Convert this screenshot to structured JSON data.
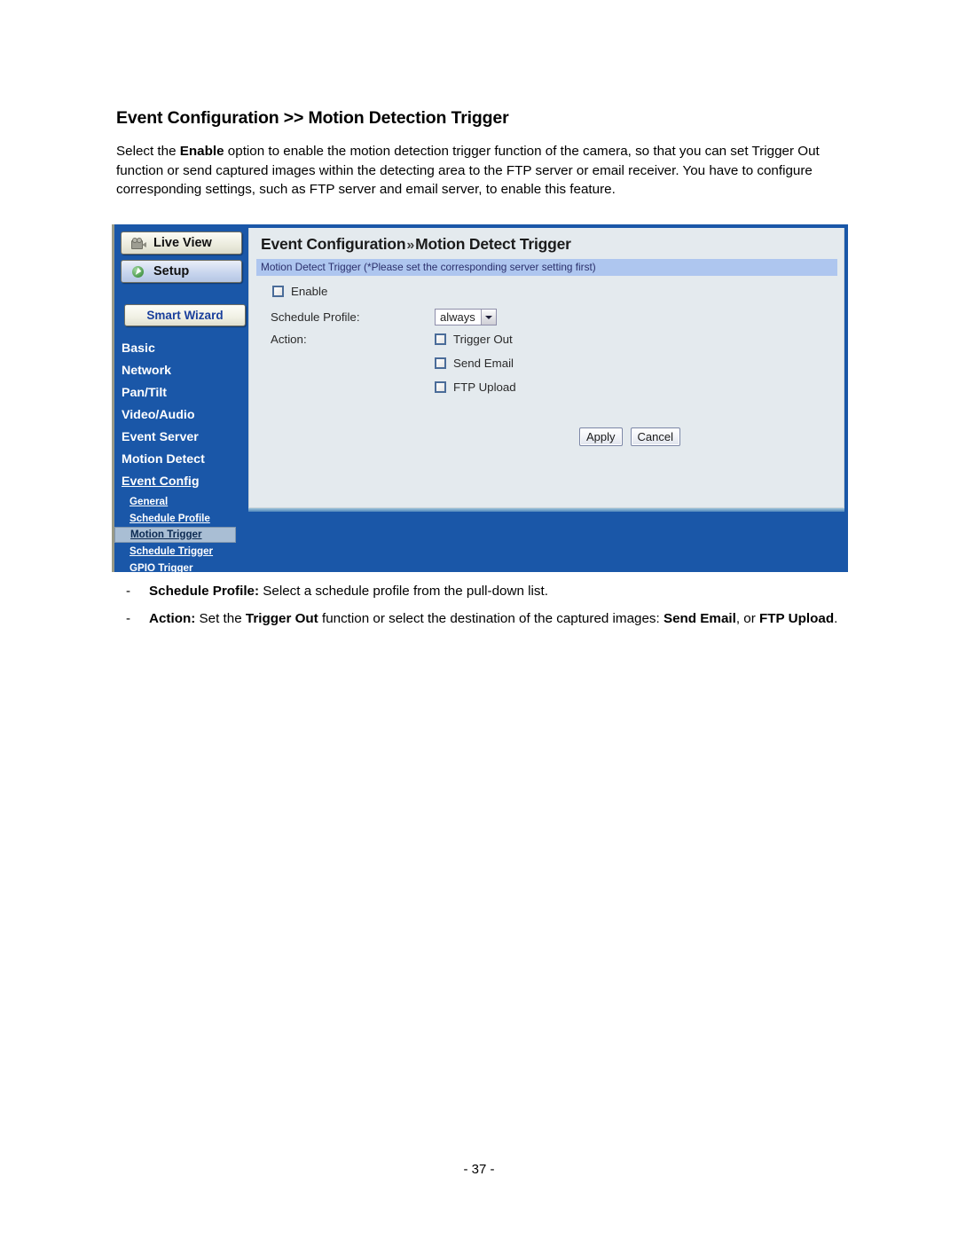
{
  "document": {
    "title": "Event Configuration >> Motion Detection Trigger",
    "intro_segments": [
      {
        "text": "Select the ",
        "bold": false
      },
      {
        "text": "Enable",
        "bold": true
      },
      {
        "text": " option to enable the motion detection trigger function of the camera, so that you can set Trigger Out function or send captured images within the detecting area to the FTP server or email receiver. You have to configure corresponding settings, such as FTP server and email server, to enable this feature.",
        "bold": false
      }
    ],
    "page_number": "- 37 -"
  },
  "notes": [
    {
      "dash": "-",
      "segments": [
        {
          "text": "Schedule Profile:",
          "bold": true
        },
        {
          "text": " Select a schedule profile from the pull-down list.",
          "bold": false
        }
      ]
    },
    {
      "dash": "-",
      "segments": [
        {
          "text": "Action:",
          "bold": true
        },
        {
          "text": " Set the ",
          "bold": false
        },
        {
          "text": "Trigger Out",
          "bold": true
        },
        {
          "text": " function or select the destination of the captured images: ",
          "bold": false
        },
        {
          "text": "Send Email",
          "bold": true
        },
        {
          "text": ", or ",
          "bold": false
        },
        {
          "text": "FTP Upload",
          "bold": true
        },
        {
          "text": ".",
          "bold": false
        }
      ]
    }
  ],
  "camera_ui": {
    "sidebar": {
      "live_view_label": "Live View",
      "setup_label": "Setup",
      "smart_wizard_label": "Smart Wizard",
      "main_items": [
        {
          "label": "Basic",
          "active": false
        },
        {
          "label": "Network",
          "active": false
        },
        {
          "label": "Pan/Tilt",
          "active": false
        },
        {
          "label": "Video/Audio",
          "active": false
        },
        {
          "label": "Event Server",
          "active": false
        },
        {
          "label": "Motion Detect",
          "active": false
        },
        {
          "label": "Event Config",
          "active": true
        }
      ],
      "sub_items": [
        {
          "label": "General",
          "selected": false
        },
        {
          "label": "Schedule Profile",
          "selected": false
        },
        {
          "label": "Motion Trigger",
          "selected": true
        },
        {
          "label": "Schedule Trigger",
          "selected": false
        },
        {
          "label": "GPIO Trigger",
          "selected": false
        }
      ]
    },
    "pane": {
      "title_left": "Event Configuration",
      "title_chevron": "»",
      "title_right": "Motion Detect Trigger",
      "subbar": "Motion Detect Trigger  (*Please set the corresponding server setting first)",
      "enable_label": "Enable",
      "enable_checked": false,
      "schedule_profile_label": "Schedule Profile:",
      "schedule_profile_value": "always",
      "action_label": "Action:",
      "action_options": [
        {
          "label": "Trigger Out",
          "checked": false
        },
        {
          "label": "Send Email",
          "checked": false
        },
        {
          "label": "FTP Upload",
          "checked": false
        }
      ],
      "apply_label": "Apply",
      "cancel_label": "Cancel"
    },
    "colors": {
      "sidebar_blue": "#1a57a8",
      "content_bg": "#e4eaee",
      "subbar_blue": "#aec6ef",
      "selected_item_bg": "#a9bed4"
    }
  }
}
